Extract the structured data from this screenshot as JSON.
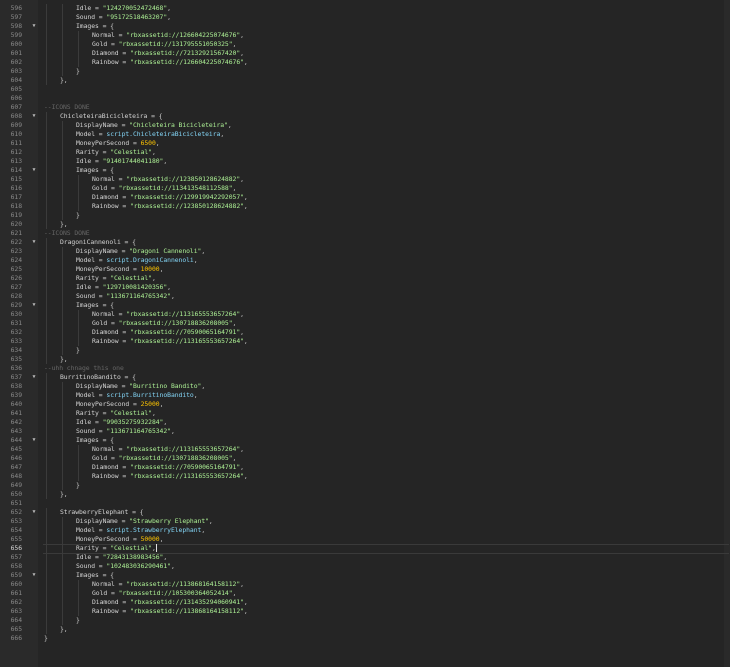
{
  "editor": {
    "colors": {
      "background": "#252525",
      "gutter": "#2a2a2a",
      "line_number": "#8a8a8a",
      "string": "#adf195",
      "number": "#ffc600",
      "builtin": "#84d6f7",
      "comment": "#666666",
      "text": "#d4d4d4"
    },
    "current_line": "656",
    "lines": [
      {
        "n": "596",
        "indent": 2,
        "fold": "",
        "tokens": [
          [
            "Idle = ",
            "field"
          ],
          [
            "\"124270052472468\"",
            "str"
          ],
          [
            ",",
            "punc"
          ]
        ]
      },
      {
        "n": "597",
        "indent": 2,
        "fold": "",
        "tokens": [
          [
            "Sound = ",
            "field"
          ],
          [
            "\"95172518463207\"",
            "str"
          ],
          [
            ",",
            "punc"
          ]
        ]
      },
      {
        "n": "598",
        "indent": 2,
        "fold": "▼",
        "tokens": [
          [
            "Images = {",
            "field"
          ]
        ]
      },
      {
        "n": "599",
        "indent": 3,
        "fold": "",
        "tokens": [
          [
            "Normal = ",
            "field"
          ],
          [
            "\"rbxassetid://126604225074676\"",
            "str"
          ],
          [
            ",",
            "punc"
          ]
        ]
      },
      {
        "n": "600",
        "indent": 3,
        "fold": "",
        "tokens": [
          [
            "Gold = ",
            "field"
          ],
          [
            "\"rbxassetid://131795551050325\"",
            "str"
          ],
          [
            ",",
            "punc"
          ]
        ]
      },
      {
        "n": "601",
        "indent": 3,
        "fold": "",
        "tokens": [
          [
            "Diamond = ",
            "field"
          ],
          [
            "\"rbxassetid://72132921567420\"",
            "str"
          ],
          [
            ",",
            "punc"
          ]
        ]
      },
      {
        "n": "602",
        "indent": 3,
        "fold": "",
        "tokens": [
          [
            "Rainbow = ",
            "field"
          ],
          [
            "\"rbxassetid://126604225074676\"",
            "str"
          ],
          [
            ",",
            "punc"
          ]
        ]
      },
      {
        "n": "603",
        "indent": 2,
        "fold": "",
        "tokens": [
          [
            "}",
            "punc"
          ]
        ]
      },
      {
        "n": "604",
        "indent": 1,
        "fold": "",
        "tokens": [
          [
            "},",
            "punc"
          ]
        ]
      },
      {
        "n": "605",
        "indent": 0,
        "fold": "",
        "tokens": []
      },
      {
        "n": "606",
        "indent": 0,
        "fold": "",
        "tokens": []
      },
      {
        "n": "607",
        "indent": 0,
        "fold": "",
        "tokens": [
          [
            "--ICONS DONE",
            "comment"
          ]
        ]
      },
      {
        "n": "608",
        "indent": 1,
        "fold": "▼",
        "tokens": [
          [
            "ChicleteiraBicicleteira = {",
            "field"
          ]
        ]
      },
      {
        "n": "609",
        "indent": 2,
        "fold": "",
        "tokens": [
          [
            "DisplayName = ",
            "field"
          ],
          [
            "\"Chicleteira Bicicleteira\"",
            "str"
          ],
          [
            ",",
            "punc"
          ]
        ]
      },
      {
        "n": "610",
        "indent": 2,
        "fold": "",
        "tokens": [
          [
            "Model = ",
            "field"
          ],
          [
            "script.ChicleteiraBicicleteira",
            "builtin"
          ],
          [
            ",",
            "punc"
          ]
        ]
      },
      {
        "n": "611",
        "indent": 2,
        "fold": "",
        "tokens": [
          [
            "MoneyPerSecond = ",
            "field"
          ],
          [
            "6500",
            "num"
          ],
          [
            ",",
            "punc"
          ]
        ]
      },
      {
        "n": "612",
        "indent": 2,
        "fold": "",
        "tokens": [
          [
            "Rarity = ",
            "field"
          ],
          [
            "\"Celestial\"",
            "str"
          ],
          [
            ",",
            "punc"
          ]
        ]
      },
      {
        "n": "613",
        "indent": 2,
        "fold": "",
        "tokens": [
          [
            "Idle = ",
            "field"
          ],
          [
            "\"91401744041180\"",
            "str"
          ],
          [
            ",",
            "punc"
          ]
        ]
      },
      {
        "n": "614",
        "indent": 2,
        "fold": "▼",
        "tokens": [
          [
            "Images = {",
            "field"
          ]
        ]
      },
      {
        "n": "615",
        "indent": 3,
        "fold": "",
        "tokens": [
          [
            "Normal = ",
            "field"
          ],
          [
            "\"rbxassetid://123850128624882\"",
            "str"
          ],
          [
            ",",
            "punc"
          ]
        ]
      },
      {
        "n": "616",
        "indent": 3,
        "fold": "",
        "tokens": [
          [
            "Gold = ",
            "field"
          ],
          [
            "\"rbxassetid://113413548112588\"",
            "str"
          ],
          [
            ",",
            "punc"
          ]
        ]
      },
      {
        "n": "617",
        "indent": 3,
        "fold": "",
        "tokens": [
          [
            "Diamond = ",
            "field"
          ],
          [
            "\"rbxassetid://129919942292057\"",
            "str"
          ],
          [
            ",",
            "punc"
          ]
        ]
      },
      {
        "n": "618",
        "indent": 3,
        "fold": "",
        "tokens": [
          [
            "Rainbow = ",
            "field"
          ],
          [
            "\"rbxassetid://123850128624882\"",
            "str"
          ],
          [
            ",",
            "punc"
          ]
        ]
      },
      {
        "n": "619",
        "indent": 2,
        "fold": "",
        "tokens": [
          [
            "}",
            "punc"
          ]
        ]
      },
      {
        "n": "620",
        "indent": 1,
        "fold": "",
        "tokens": [
          [
            "},",
            "punc"
          ]
        ]
      },
      {
        "n": "621",
        "indent": 0,
        "fold": "",
        "tokens": [
          [
            "--ICONS DONE",
            "comment"
          ]
        ]
      },
      {
        "n": "622",
        "indent": 1,
        "fold": "▼",
        "tokens": [
          [
            "DragoniCannenoli = {",
            "field"
          ]
        ]
      },
      {
        "n": "623",
        "indent": 2,
        "fold": "",
        "tokens": [
          [
            "DisplayName = ",
            "field"
          ],
          [
            "\"Dragoni Cannenoli\"",
            "str"
          ],
          [
            ",",
            "punc"
          ]
        ]
      },
      {
        "n": "624",
        "indent": 2,
        "fold": "",
        "tokens": [
          [
            "Model = ",
            "field"
          ],
          [
            "script.DragoniCannenoli",
            "builtin"
          ],
          [
            ",",
            "punc"
          ]
        ]
      },
      {
        "n": "625",
        "indent": 2,
        "fold": "",
        "tokens": [
          [
            "MoneyPerSecond = ",
            "field"
          ],
          [
            "10000",
            "num"
          ],
          [
            ",",
            "punc"
          ]
        ]
      },
      {
        "n": "626",
        "indent": 2,
        "fold": "",
        "tokens": [
          [
            "Rarity = ",
            "field"
          ],
          [
            "\"Celestial\"",
            "str"
          ],
          [
            ",",
            "punc"
          ]
        ]
      },
      {
        "n": "627",
        "indent": 2,
        "fold": "",
        "tokens": [
          [
            "Idle = ",
            "field"
          ],
          [
            "\"129710081420356\"",
            "str"
          ],
          [
            ",",
            "punc"
          ]
        ]
      },
      {
        "n": "628",
        "indent": 2,
        "fold": "",
        "tokens": [
          [
            "Sound = ",
            "field"
          ],
          [
            "\"113671164765342\"",
            "str"
          ],
          [
            ",",
            "punc"
          ]
        ]
      },
      {
        "n": "629",
        "indent": 2,
        "fold": "▼",
        "tokens": [
          [
            "Images = {",
            "field"
          ]
        ]
      },
      {
        "n": "630",
        "indent": 3,
        "fold": "",
        "tokens": [
          [
            "Normal = ",
            "field"
          ],
          [
            "\"rbxassetid://113165553657264\"",
            "str"
          ],
          [
            ",",
            "punc"
          ]
        ]
      },
      {
        "n": "631",
        "indent": 3,
        "fold": "",
        "tokens": [
          [
            "Gold = ",
            "field"
          ],
          [
            "\"rbxassetid://130718836208005\"",
            "str"
          ],
          [
            ",",
            "punc"
          ]
        ]
      },
      {
        "n": "632",
        "indent": 3,
        "fold": "",
        "tokens": [
          [
            "Diamond = ",
            "field"
          ],
          [
            "\"rbxassetid://70590065164791\"",
            "str"
          ],
          [
            ",",
            "punc"
          ]
        ]
      },
      {
        "n": "633",
        "indent": 3,
        "fold": "",
        "tokens": [
          [
            "Rainbow = ",
            "field"
          ],
          [
            "\"rbxassetid://113165553657264\"",
            "str"
          ],
          [
            ",",
            "punc"
          ]
        ]
      },
      {
        "n": "634",
        "indent": 2,
        "fold": "",
        "tokens": [
          [
            "}",
            "punc"
          ]
        ]
      },
      {
        "n": "635",
        "indent": 1,
        "fold": "",
        "tokens": [
          [
            "},",
            "punc"
          ]
        ]
      },
      {
        "n": "636",
        "indent": 0,
        "fold": "",
        "tokens": [
          [
            "--uhh chnage this one",
            "comment"
          ]
        ]
      },
      {
        "n": "637",
        "indent": 1,
        "fold": "▼",
        "tokens": [
          [
            "BurritinoBandito = {",
            "field"
          ]
        ]
      },
      {
        "n": "638",
        "indent": 2,
        "fold": "",
        "tokens": [
          [
            "DisplayName = ",
            "field"
          ],
          [
            "\"Burritino Bandito\"",
            "str"
          ],
          [
            ",",
            "punc"
          ]
        ]
      },
      {
        "n": "639",
        "indent": 2,
        "fold": "",
        "tokens": [
          [
            "Model = ",
            "field"
          ],
          [
            "script.BurritinoBandito",
            "builtin"
          ],
          [
            ",",
            "punc"
          ]
        ]
      },
      {
        "n": "640",
        "indent": 2,
        "fold": "",
        "tokens": [
          [
            "MoneyPerSecond = ",
            "field"
          ],
          [
            "25000",
            "num"
          ],
          [
            ",",
            "punc"
          ]
        ]
      },
      {
        "n": "641",
        "indent": 2,
        "fold": "",
        "tokens": [
          [
            "Rarity = ",
            "field"
          ],
          [
            "\"Celestial\"",
            "str"
          ],
          [
            ",",
            "punc"
          ]
        ]
      },
      {
        "n": "642",
        "indent": 2,
        "fold": "",
        "tokens": [
          [
            "Idle = ",
            "field"
          ],
          [
            "\"99035275932284\"",
            "str"
          ],
          [
            ",",
            "punc"
          ]
        ]
      },
      {
        "n": "643",
        "indent": 2,
        "fold": "",
        "tokens": [
          [
            "Sound = ",
            "field"
          ],
          [
            "\"113671164765342\"",
            "str"
          ],
          [
            ",",
            "punc"
          ]
        ]
      },
      {
        "n": "644",
        "indent": 2,
        "fold": "▼",
        "tokens": [
          [
            "Images = {",
            "field"
          ]
        ]
      },
      {
        "n": "645",
        "indent": 3,
        "fold": "",
        "tokens": [
          [
            "Normal = ",
            "field"
          ],
          [
            "\"rbxassetid://113165553657264\"",
            "str"
          ],
          [
            ",",
            "punc"
          ]
        ]
      },
      {
        "n": "646",
        "indent": 3,
        "fold": "",
        "tokens": [
          [
            "Gold = ",
            "field"
          ],
          [
            "\"rbxassetid://130718836208005\"",
            "str"
          ],
          [
            ",",
            "punc"
          ]
        ]
      },
      {
        "n": "647",
        "indent": 3,
        "fold": "",
        "tokens": [
          [
            "Diamond = ",
            "field"
          ],
          [
            "\"rbxassetid://70590065164791\"",
            "str"
          ],
          [
            ",",
            "punc"
          ]
        ]
      },
      {
        "n": "648",
        "indent": 3,
        "fold": "",
        "tokens": [
          [
            "Rainbow = ",
            "field"
          ],
          [
            "\"rbxassetid://113165553657264\"",
            "str"
          ],
          [
            ",",
            "punc"
          ]
        ]
      },
      {
        "n": "649",
        "indent": 2,
        "fold": "",
        "tokens": [
          [
            "}",
            "punc"
          ]
        ]
      },
      {
        "n": "650",
        "indent": 1,
        "fold": "",
        "tokens": [
          [
            "},",
            "punc"
          ]
        ]
      },
      {
        "n": "651",
        "indent": 0,
        "fold": "",
        "tokens": []
      },
      {
        "n": "652",
        "indent": 1,
        "fold": "▼",
        "tokens": [
          [
            "StrawberryElephant = {",
            "field"
          ]
        ]
      },
      {
        "n": "653",
        "indent": 2,
        "fold": "",
        "tokens": [
          [
            "DisplayName = ",
            "field"
          ],
          [
            "\"Strawberry Elephant\"",
            "str"
          ],
          [
            ",",
            "punc"
          ]
        ]
      },
      {
        "n": "654",
        "indent": 2,
        "fold": "",
        "tokens": [
          [
            "Model = ",
            "field"
          ],
          [
            "script.StrawberryElephant",
            "builtin"
          ],
          [
            ",",
            "punc"
          ]
        ]
      },
      {
        "n": "655",
        "indent": 2,
        "fold": "",
        "tokens": [
          [
            "MoneyPerSecond = ",
            "field"
          ],
          [
            "50000",
            "num"
          ],
          [
            ",",
            "punc"
          ]
        ]
      },
      {
        "n": "656",
        "indent": 2,
        "fold": "",
        "tokens": [
          [
            "Rarity = ",
            "field"
          ],
          [
            "\"Celestial\"",
            "str"
          ],
          [
            ",",
            "punc"
          ]
        ]
      },
      {
        "n": "657",
        "indent": 2,
        "fold": "",
        "tokens": [
          [
            "Idle = ",
            "field"
          ],
          [
            "\"72843138983456\"",
            "str"
          ],
          [
            ",",
            "punc"
          ]
        ]
      },
      {
        "n": "658",
        "indent": 2,
        "fold": "",
        "tokens": [
          [
            "Sound = ",
            "field"
          ],
          [
            "\"102483036290461\"",
            "str"
          ],
          [
            ",",
            "punc"
          ]
        ]
      },
      {
        "n": "659",
        "indent": 2,
        "fold": "▼",
        "tokens": [
          [
            "Images = {",
            "field"
          ]
        ]
      },
      {
        "n": "660",
        "indent": 3,
        "fold": "",
        "tokens": [
          [
            "Normal = ",
            "field"
          ],
          [
            "\"rbxassetid://113868164158112\"",
            "str"
          ],
          [
            ",",
            "punc"
          ]
        ]
      },
      {
        "n": "661",
        "indent": 3,
        "fold": "",
        "tokens": [
          [
            "Gold = ",
            "field"
          ],
          [
            "\"rbxassetid://105300364052414\"",
            "str"
          ],
          [
            ",",
            "punc"
          ]
        ]
      },
      {
        "n": "662",
        "indent": 3,
        "fold": "",
        "tokens": [
          [
            "Diamond = ",
            "field"
          ],
          [
            "\"rbxassetid://131435294060941\"",
            "str"
          ],
          [
            ",",
            "punc"
          ]
        ]
      },
      {
        "n": "663",
        "indent": 3,
        "fold": "",
        "tokens": [
          [
            "Rainbow = ",
            "field"
          ],
          [
            "\"rbxassetid://113868164158112\"",
            "str"
          ],
          [
            ",",
            "punc"
          ]
        ]
      },
      {
        "n": "664",
        "indent": 2,
        "fold": "",
        "tokens": [
          [
            "}",
            "punc"
          ]
        ]
      },
      {
        "n": "665",
        "indent": 1,
        "fold": "",
        "tokens": [
          [
            "},",
            "punc"
          ]
        ]
      },
      {
        "n": "666",
        "indent": 0,
        "fold": "",
        "tokens": [
          [
            "}",
            "punc"
          ]
        ]
      }
    ]
  }
}
